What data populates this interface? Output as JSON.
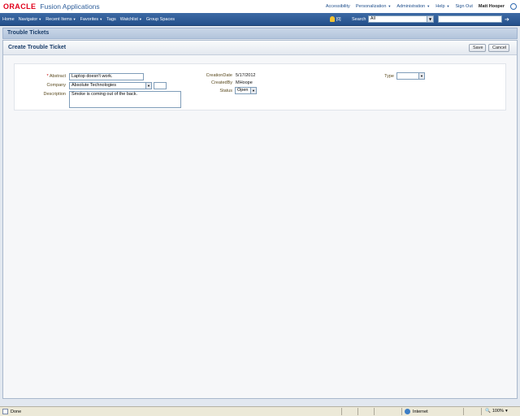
{
  "header": {
    "oracle": "ORACLE",
    "product": "Fusion Applications",
    "links": [
      "Accessibility",
      "Personalization",
      "Administration",
      "Help",
      "Sign Out"
    ],
    "user": "Matt Hooper"
  },
  "nav": {
    "items": [
      "Home",
      "Navigator",
      "Recent Items",
      "Favorites",
      "Tags",
      "Watchlist",
      "Group Spaces"
    ],
    "watch_count": "[0]",
    "search_label": "Search",
    "search_scope": "All",
    "search_value": ""
  },
  "page": {
    "title": "Trouble Tickets",
    "subheader": "Create Trouble Ticket",
    "save_label": "Save",
    "cancel_label": "Cancel"
  },
  "form": {
    "abstract_label": "Abstract",
    "abstract_value": "Laptop doesn't work.",
    "company_label": "Company",
    "company_value": "Absolute Technologies",
    "description_label": "Description",
    "description_value": "Smoke is coming out of the back.",
    "creation_date_label": "CreationDate",
    "creation_date_value": "5/17/2012",
    "created_by_label": "CreatedBy",
    "created_by_value": "MHoope",
    "status_label": "Status",
    "status_value": "Open",
    "type_label": "Type",
    "type_value": ""
  },
  "statusbar": {
    "done": "Done",
    "zone": "Internet",
    "zoom": "100%"
  },
  "colors": {
    "oracle_red": "#e0001b",
    "nav_blue": "#24508b",
    "title_blue": "#1b3e6a"
  }
}
